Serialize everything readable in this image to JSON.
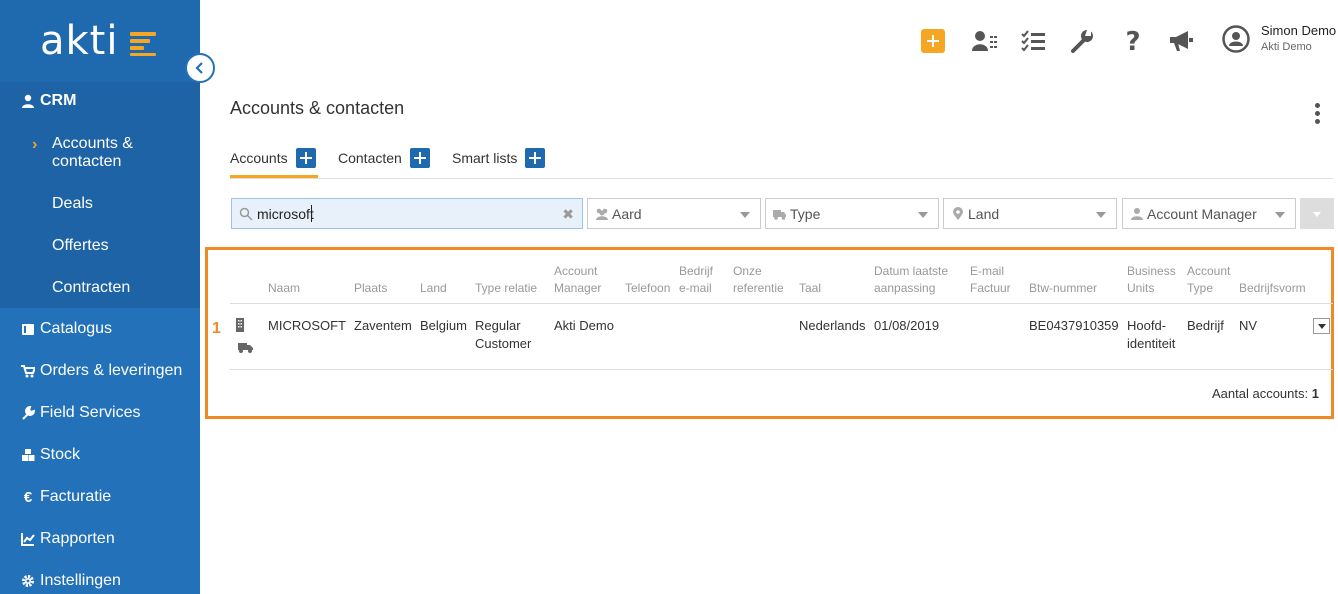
{
  "logo": {
    "text": "akti"
  },
  "sidebar": {
    "crm": "CRM",
    "sub": [
      "Accounts &",
      "contacten",
      "Deals",
      "Offertes",
      "Contracten"
    ],
    "items": [
      "Catalogus",
      "Orders & leveringen",
      "Field Services",
      "Stock",
      "Facturatie",
      "Rapporten",
      "Instellingen"
    ]
  },
  "user": {
    "name": "Simon Demo",
    "company": "Akti Demo"
  },
  "page": {
    "title": "Accounts & contacten"
  },
  "tabs": [
    {
      "label": "Accounts"
    },
    {
      "label": "Contacten"
    },
    {
      "label": "Smart lists"
    }
  ],
  "search": {
    "value": "microsoft"
  },
  "filters": [
    "Aard",
    "Type",
    "Land",
    "Account Manager"
  ],
  "table": {
    "marker": "1",
    "headers": [
      [
        "Naam"
      ],
      [
        "Plaats"
      ],
      [
        "Land"
      ],
      [
        "Type relatie"
      ],
      [
        "Account",
        "Manager"
      ],
      [
        "Telefoon"
      ],
      [
        "Bedrijf",
        "e-mail"
      ],
      [
        "Onze",
        "referentie"
      ],
      [
        "Taal"
      ],
      [
        "Datum laatste",
        "aanpassing"
      ],
      [
        "E-mail",
        "Factuur"
      ],
      [
        "Btw-nummer"
      ],
      [
        "Business",
        "Units"
      ],
      [
        "Account",
        "Type"
      ],
      [
        "Bedrijfsvorm"
      ]
    ],
    "row": {
      "naam": "MICROSOFT",
      "plaats": "Zaventem",
      "land": "Belgium",
      "type_relatie": [
        "Regular",
        "Customer"
      ],
      "account_manager": "Akti Demo",
      "taal": "Nederlands",
      "datum": "01/08/2019",
      "btw": "BE0437910359",
      "business_units": [
        "Hoofd-",
        "identiteit"
      ],
      "account_type": "Bedrijf",
      "bedrijfsvorm": "NV"
    },
    "count_label": "Aantal accounts:",
    "count_value": "1"
  }
}
